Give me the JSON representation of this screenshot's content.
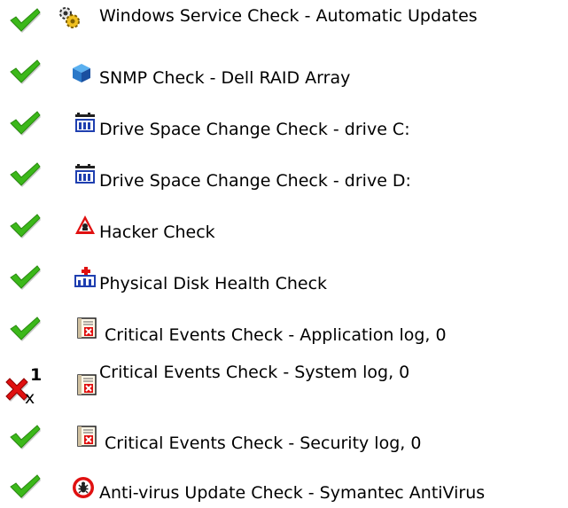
{
  "checks": [
    {
      "status": "pass",
      "icon": "gear-service-icon",
      "label": "Windows Service Check - Automatic Updates"
    },
    {
      "status": "pass",
      "icon": "snmp-cube-icon",
      "label": "SNMP Check - Dell RAID Array"
    },
    {
      "status": "pass",
      "icon": "drive-space-icon",
      "label": "Drive Space Change Check - drive C:"
    },
    {
      "status": "pass",
      "icon": "drive-space-icon",
      "label": "Drive Space Change Check - drive D:"
    },
    {
      "status": "pass",
      "icon": "hacker-warning-icon",
      "label": "Hacker Check"
    },
    {
      "status": "pass",
      "icon": "disk-health-icon",
      "label": "Physical Disk Health Check"
    },
    {
      "status": "pass",
      "icon": "event-log-icon",
      "label": "Critical Events Check - Application log, 0"
    },
    {
      "status": "fail",
      "icon": "event-log-icon",
      "label": "Critical Events Check - System log, 0",
      "fail_count": "1",
      "fail_suffix": "x"
    },
    {
      "status": "pass",
      "icon": "event-log-icon",
      "label": "Critical Events Check - Security log, 0"
    },
    {
      "status": "pass",
      "icon": "antivirus-icon",
      "label": "Anti-virus Update Check - Symantec AntiVirus"
    }
  ],
  "colors": {
    "pass": "#3cb81a",
    "fail": "#e01010",
    "accent": "#1f3fb0"
  }
}
